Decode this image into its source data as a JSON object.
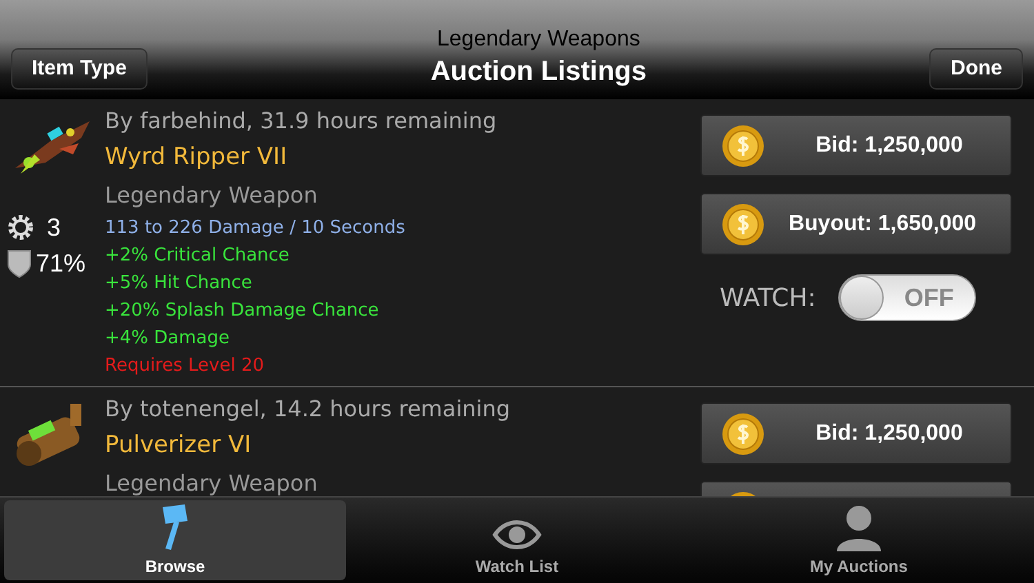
{
  "nav_bar": {
    "subtitle": "Legendary Weapons",
    "title": "Auction Listings",
    "back_button": "Item Type",
    "done_button": "Done"
  },
  "listings": [
    {
      "seller_line": "By farbehind, 31.9 hours remaining",
      "name": "Wyrd Ripper VII",
      "type": "Legendary Weapon",
      "slots": "3",
      "condition": "71%",
      "stats": [
        {
          "kind": "damage",
          "text": "113 to 226 Damage / 10 Seconds"
        },
        {
          "kind": "bonus",
          "text": "+2% Critical Chance"
        },
        {
          "kind": "bonus",
          "text": "+5% Hit Chance"
        },
        {
          "kind": "bonus",
          "text": "+20% Splash Damage Chance"
        },
        {
          "kind": "bonus",
          "text": "+4% Damage"
        },
        {
          "kind": "requirement",
          "text": "Requires Level 20"
        }
      ],
      "buttons": [
        {
          "kind": "bid",
          "label": "Bid: 1,250,000"
        },
        {
          "kind": "buyout",
          "label": "Buyout: 1,650,000"
        }
      ],
      "watch": {
        "label": "WATCH:",
        "on": false,
        "state_text": "OFF"
      }
    },
    {
      "seller_line": "By totenengel, 14.2 hours remaining",
      "name": "Pulverizer VI",
      "type": "Legendary Weapon",
      "buttons": [
        {
          "kind": "bid",
          "label": "Bid: 1,250,000"
        },
        {
          "kind": "buyout"
        }
      ]
    }
  ],
  "tab_bar": [
    {
      "label": "Browse",
      "kind": "browse",
      "selected": true
    },
    {
      "label": "Watch List",
      "kind": "watch",
      "selected": false
    },
    {
      "label": "My Auctions",
      "kind": "auctions",
      "selected": false
    }
  ]
}
